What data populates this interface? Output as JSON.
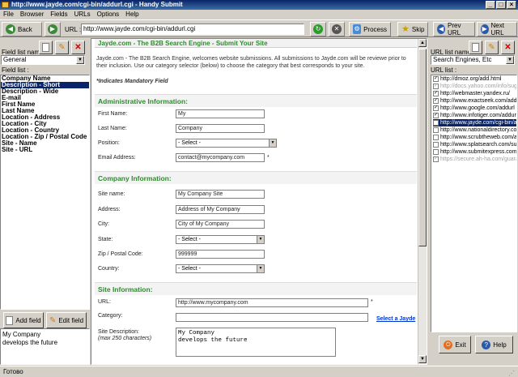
{
  "window": {
    "title": "http://www.jayde.com/cgi-bin/addurl.cgi - Handy Submit"
  },
  "menu": [
    "File",
    "Browser",
    "Fields",
    "URLs",
    "Options",
    "Help"
  ],
  "toolbar": {
    "back_label": "Back",
    "url_label": "URL :",
    "url_value": "http://www.jayde.com/cgi-bin/addurl.cgi",
    "process_label": "Process",
    "skip_label": "Skip",
    "prev_label": "Prev URL",
    "next_label": "Next URL"
  },
  "left": {
    "field_list_name_label": "Field list name :",
    "field_list_select": "General",
    "field_list_label": "Field list :",
    "fields": [
      "Company Name",
      "Description - Short",
      "Description - Wide",
      "E-mail",
      "First Name",
      "Last Name",
      "Location - Address",
      "Location - City",
      "Location - Country",
      "Location - Zip / Postal Code",
      "Site - Name",
      "Site - URL"
    ],
    "selected_index": 1,
    "add_field_label": "Add field",
    "edit_field_label": "Edit field",
    "note_lines": [
      "My Company",
      "develops the future"
    ]
  },
  "right": {
    "url_list_name_label": "URL list name :",
    "url_list_select": "Search Engines, Etc",
    "url_list_label": "URL list :",
    "urls": [
      {
        "text": "http://dmoz.org/add.html",
        "checked": true,
        "disabled": false
      },
      {
        "text": "http://docs.yahoo.com/info/sugg",
        "checked": true,
        "disabled": true
      },
      {
        "text": "http://webmaster.yandex.ru/",
        "checked": true,
        "disabled": false
      },
      {
        "text": "http://www.exactseek.com/add.",
        "checked": true,
        "disabled": false
      },
      {
        "text": "http://www.google.com/addurl",
        "checked": true,
        "disabled": false
      },
      {
        "text": "http://www.infotiger.com/addurl.",
        "checked": true,
        "disabled": false
      },
      {
        "text": "http://www.jayde.com/cgi-bin/ad",
        "checked": false,
        "disabled": false,
        "selected": true
      },
      {
        "text": "http://www.nationaldirectory.com",
        "checked": false,
        "disabled": false
      },
      {
        "text": "http://www.scrubtheweb.com/ac",
        "checked": false,
        "disabled": false
      },
      {
        "text": "http://www.splatsearch.com/sub",
        "checked": false,
        "disabled": false
      },
      {
        "text": "http://www.submitexpress.com/",
        "checked": false,
        "disabled": false
      },
      {
        "text": "https://secure.ah-ha.com/guarar",
        "checked": true,
        "disabled": true
      }
    ],
    "exit_label": "Exit",
    "help_label": "Help"
  },
  "page": {
    "header": "Jayde.com - The B2B Search Engine - Submit Your Site",
    "intro": "Jayde.com - The B2B Search Engine, welcomes website submissions. All submissions to Jayde.com will be reviewe prior to their inclusion. Use our category selector (below) to choose the category that best corresponds to your site.",
    "mandatory": "*Indicates Mandatory Field",
    "admin": {
      "title": "Administrative Information:",
      "first_name_label": "First Name:",
      "first_name": "My",
      "last_name_label": "Last Name:",
      "last_name": "Company",
      "position_label": "Position:",
      "position": "- Select -",
      "email_label": "Email Address:",
      "email": "contact@mycompany.com"
    },
    "company": {
      "title": "Company Information:",
      "site_name_label": "Site name:",
      "site_name": "My Company Site",
      "address_label": "Address:",
      "address": "Address of My Company",
      "city_label": "City:",
      "city": "City of My Company",
      "state_label": "State:",
      "state": "- Select -",
      "zip_label": "Zip / Postal Code:",
      "zip": "999999",
      "country_label": "Country:",
      "country": "- Select -"
    },
    "site": {
      "title": "Site Information:",
      "url_label": "URL:",
      "url": "http://www.mycompany.com",
      "category_label": "Category:",
      "category": "",
      "select_link": "Select a Jayde",
      "desc_label": "Site Description:",
      "desc_hint": "(max 250 characters)",
      "desc": "My Company\ndevelops the future"
    }
  },
  "status": {
    "text": "Готово"
  }
}
